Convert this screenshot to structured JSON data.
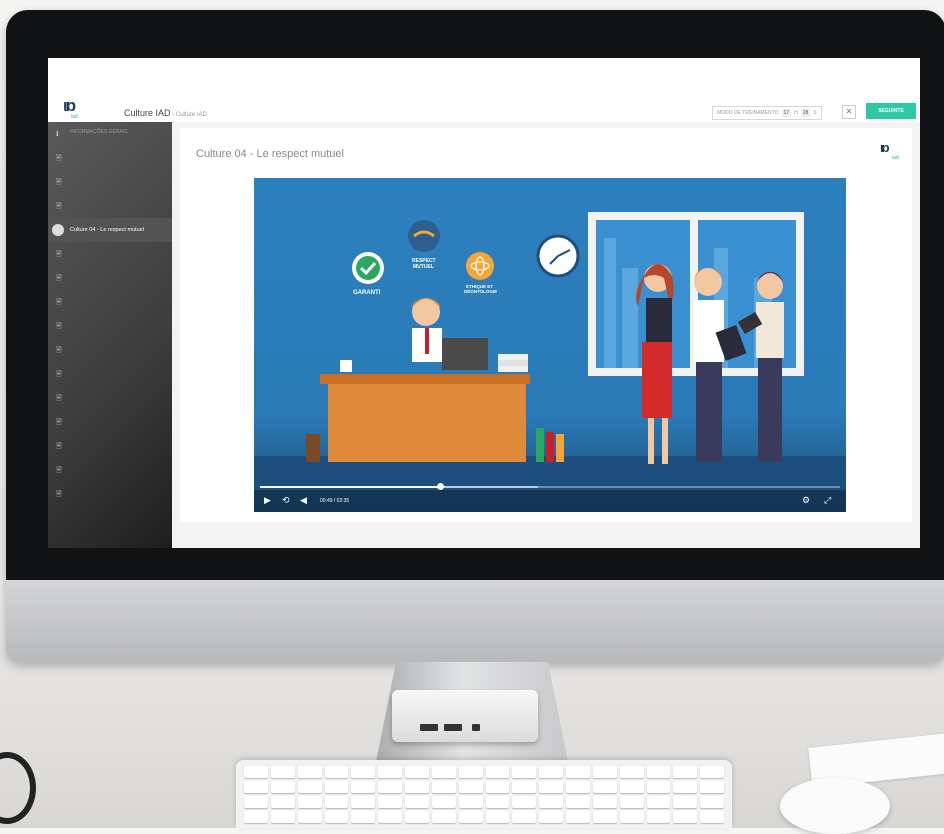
{
  "app": {
    "logo_text": "ιɒ",
    "logo_sub": "iad",
    "course_title": "Culture IAD",
    "course_sub": " - Culture IAD"
  },
  "header": {
    "trainer_label": "MODO DE TREINAMENTO",
    "hours_value": "17",
    "hours_unit": "H",
    "seconds_value": "28",
    "seconds_unit": "S",
    "close_label": "✕",
    "next_label": "SEGUINTE"
  },
  "sidebar": {
    "items": [
      {
        "icon": "ℹ",
        "label": "INFORMAÇÕES GERAIS",
        "active": false
      },
      {
        "icon": "🗎",
        "label": "",
        "active": false
      },
      {
        "icon": "🗎",
        "label": "",
        "active": false
      },
      {
        "icon": "🗎",
        "label": "",
        "active": false
      },
      {
        "icon": "",
        "label": "Culture 04 - Le respect mutuel",
        "active": true
      },
      {
        "icon": "🗎",
        "label": "",
        "active": false
      },
      {
        "icon": "🗎",
        "label": "",
        "active": false
      },
      {
        "icon": "🗎",
        "label": "",
        "active": false
      },
      {
        "icon": "🗎",
        "label": "",
        "active": false
      },
      {
        "icon": "🗎",
        "label": "",
        "active": false
      },
      {
        "icon": "🗎",
        "label": "",
        "active": false
      },
      {
        "icon": "🗎",
        "label": "",
        "active": false
      },
      {
        "icon": "🗎",
        "label": "",
        "active": false
      },
      {
        "icon": "🗎",
        "label": "",
        "active": false
      },
      {
        "icon": "🗎",
        "label": "",
        "active": false
      },
      {
        "icon": "🗎",
        "label": "",
        "active": false
      }
    ]
  },
  "lesson": {
    "title": "Culture 04 - Le respect mutuel",
    "logo_text": "ιɒ",
    "logo_sub": "iad"
  },
  "video": {
    "badges": {
      "garanti": "GARANTI",
      "respect_line1": "RESPECT",
      "respect_line2": "MUTUEL",
      "ethique_line1": "ÉTHIQUE ET",
      "ethique_line2": "DÉONTOLOGIE"
    },
    "time_display": "00:49 / 02:35",
    "progress": 0.31,
    "buffered": 0.48,
    "play_icon": "play-icon",
    "colors": {
      "background": "#2c7fbd",
      "desk": "#e08a3c",
      "green_badge": "#2aa861",
      "accent_orange": "#f6a636"
    }
  }
}
